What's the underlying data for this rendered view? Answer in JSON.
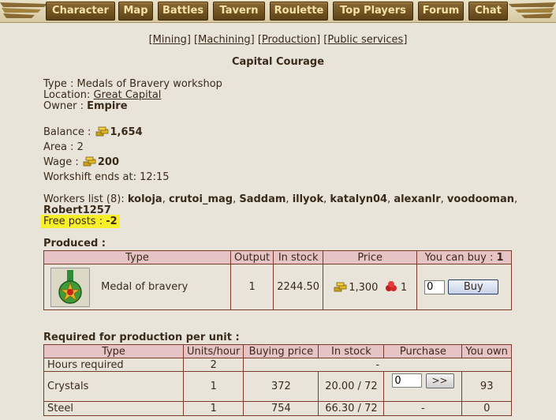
{
  "nav": {
    "items": [
      {
        "label": "Character"
      },
      {
        "label": "Map"
      },
      {
        "label": "Battles"
      },
      {
        "label": "Tavern"
      },
      {
        "label": "Roulette"
      },
      {
        "label": "Top Players"
      },
      {
        "label": "Forum"
      },
      {
        "label": "Chat"
      }
    ]
  },
  "submenu": {
    "items": [
      "Mining",
      "Machining",
      "Production",
      "Public services"
    ]
  },
  "building": {
    "title": "Capital Courage",
    "type_label": "Type : ",
    "type_value": "Medals of Bravery workshop",
    "location_label": "Location: ",
    "location_value": "Great Capital",
    "owner_label": "Owner : ",
    "owner_value": "Empire",
    "balance_label": "Balance : ",
    "balance_value": "1,654",
    "area_label": "Area : ",
    "area_value": "2",
    "wage_label": "Wage : ",
    "wage_value": "200",
    "workshift_label": "Workshift ends at: ",
    "workshift_value": "12:15",
    "workers_label": "Workers list (8): ",
    "workers": [
      "koloja",
      "crutoi_mag",
      "Saddam",
      "illyok",
      "katalyn04",
      "alexanlr",
      "voodooman",
      "Robert1257"
    ],
    "free_posts_label": "Free posts : ",
    "free_posts_value": "-2",
    "icons": {
      "currency": "gold-icon",
      "resource": "ruby-icon"
    }
  },
  "produced": {
    "heading": "Produced :",
    "headers": [
      "Type",
      "Output",
      "In stock",
      "Price",
      "You can buy : "
    ],
    "can_buy": "1",
    "row": {
      "name": "Medal of bravery",
      "output": "1",
      "stock": "2244.50",
      "price_gold": "1,300",
      "price_gem": "1",
      "qty": "0",
      "buy_label": "Buy"
    }
  },
  "required": {
    "heading": "Required for production per unit :",
    "headers": [
      "Type",
      "Units/hour",
      "Buying price",
      "In stock",
      "Purchase",
      "You own"
    ],
    "rows": [
      {
        "type": "Hours required",
        "units": "2",
        "merged": "-"
      },
      {
        "type": "Crystals",
        "units": "1",
        "price": "372",
        "stock": "20.00 / 72",
        "qty": "0",
        "btn": ">>",
        "own": "93"
      },
      {
        "type": "Steel",
        "units": "1",
        "price": "754",
        "stock": "66.30 / 72",
        "purchase": "-",
        "own": "0"
      }
    ]
  },
  "colors": {
    "nav_bg": "#6f5020",
    "nav_text": "#f4e2a8",
    "table_header": "#e6c4c6",
    "table_border": "#7a3b2a",
    "highlight": "#f7ef2a"
  }
}
